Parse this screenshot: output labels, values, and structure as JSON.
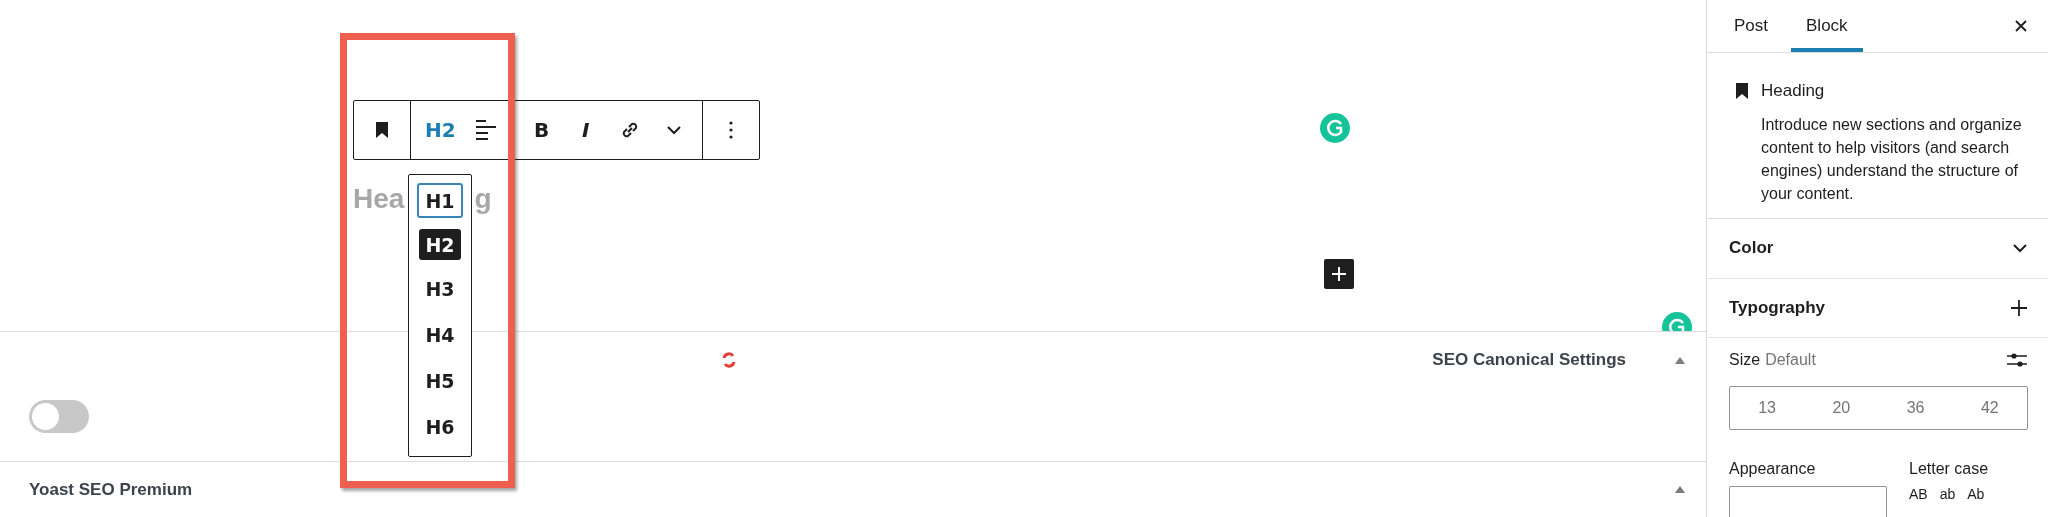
{
  "toolbar": {
    "level_button": "H2",
    "bold": "B",
    "italic": "I"
  },
  "canvas": {
    "heading_parts": [
      "Hea",
      "g"
    ]
  },
  "heading_levels": [
    {
      "label": "H1",
      "selected": false,
      "focused": true
    },
    {
      "label": "H2",
      "selected": true,
      "focused": false
    },
    {
      "label": "H3",
      "selected": false,
      "focused": false
    },
    {
      "label": "H4",
      "selected": false,
      "focused": false
    },
    {
      "label": "H5",
      "selected": false,
      "focused": false
    },
    {
      "label": "H6",
      "selected": false,
      "focused": false
    }
  ],
  "panels": [
    {
      "title": "SEO Canonical Settings",
      "expanded": true,
      "toggle": {
        "on": false
      }
    },
    {
      "title": "Yoast SEO Premium",
      "expanded": true
    }
  ],
  "sidebar": {
    "tabs": [
      {
        "label": "Post",
        "selected": false
      },
      {
        "label": "Block",
        "selected": true
      }
    ],
    "block": {
      "title": "Heading",
      "description": "Introduce new sections and organize content to help visitors (and search engines) understand the structure of your content."
    },
    "sections": [
      {
        "title": "Color",
        "kind": "collapsible"
      },
      {
        "title": "Typography",
        "kind": "tools"
      }
    ],
    "typography": {
      "size_label": "Size",
      "size_value": "Default",
      "font_sizes": [
        "13",
        "20",
        "36",
        "42"
      ],
      "appearance_label": "Appearance",
      "letter_case_label": "Letter case",
      "letter_case_options": [
        "AB",
        "ab",
        "Ab"
      ]
    }
  }
}
